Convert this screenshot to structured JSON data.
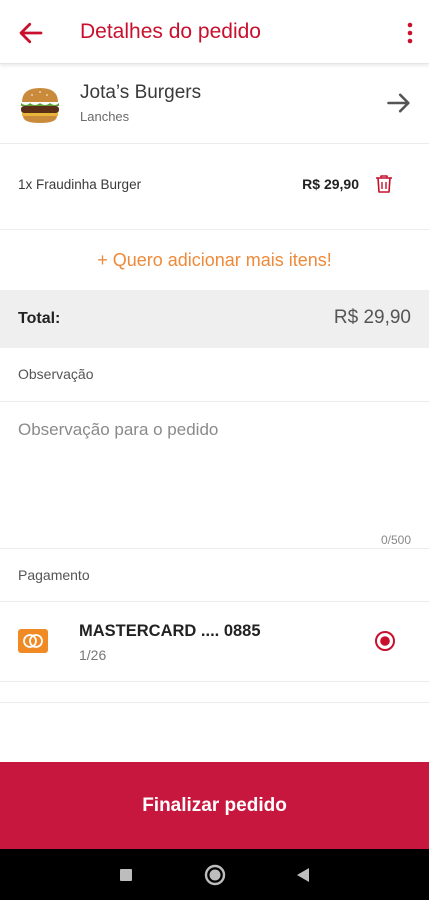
{
  "header": {
    "title": "Detalhes do pedido",
    "back_icon": "arrow-left-icon",
    "menu_icon": "more-vertical-icon",
    "accent": "#c8102e"
  },
  "store": {
    "name": "Jota’s Burgers",
    "category": "Lanches",
    "logo_icon": "burger-icon",
    "go_icon": "arrow-right-icon"
  },
  "order": {
    "items": [
      {
        "description": "1x Fraudinha Burger",
        "price": "R$ 29,90",
        "remove_icon": "trash-icon"
      }
    ],
    "add_more": "+ Quero adicionar mais itens!",
    "total_label": "Total:",
    "total_value": "R$ 29,90"
  },
  "observation": {
    "label": "Observação",
    "placeholder": "Observação para o pedido",
    "value": "",
    "counter": "0/500"
  },
  "payment": {
    "label": "Pagamento",
    "card_name": "MASTERCARD .... 0885",
    "card_expiry": "1/26",
    "card_icon": "mastercard-icon",
    "selected": true
  },
  "actions": {
    "finalize_label": "Finalizar pedido",
    "finalize_color": "#c8173f"
  },
  "system_nav": {
    "recents_icon": "square-icon",
    "home_icon": "circle-icon",
    "back_icon": "triangle-back-icon"
  }
}
